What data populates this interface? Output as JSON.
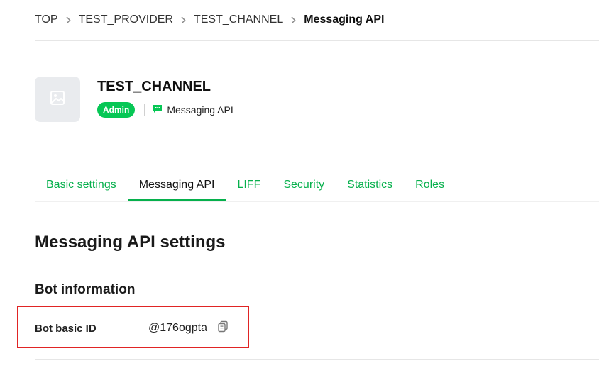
{
  "breadcrumb": {
    "items": [
      "TOP",
      "TEST_PROVIDER",
      "TEST_CHANNEL"
    ],
    "current": "Messaging API"
  },
  "channel": {
    "name": "TEST_CHANNEL",
    "role_badge": "Admin",
    "type": "Messaging API"
  },
  "tabs": [
    {
      "label": "Basic settings",
      "active": false
    },
    {
      "label": "Messaging API",
      "active": true
    },
    {
      "label": "LIFF",
      "active": false
    },
    {
      "label": "Security",
      "active": false
    },
    {
      "label": "Statistics",
      "active": false
    },
    {
      "label": "Roles",
      "active": false
    }
  ],
  "section": {
    "title": "Messaging API settings",
    "subtitle": "Bot information"
  },
  "bot_info": {
    "basic_id_label": "Bot basic ID",
    "basic_id_value": "@176ogpta"
  },
  "colors": {
    "brand_green": "#06c755",
    "tab_green": "#06b04c",
    "highlight_red": "#e02424"
  },
  "icons": {
    "breadcrumb_separator": "chevron-right-icon",
    "channel_thumbnail": "image-placeholder-icon",
    "channel_type": "chat-bubble-icon",
    "copy": "copy-icon"
  }
}
